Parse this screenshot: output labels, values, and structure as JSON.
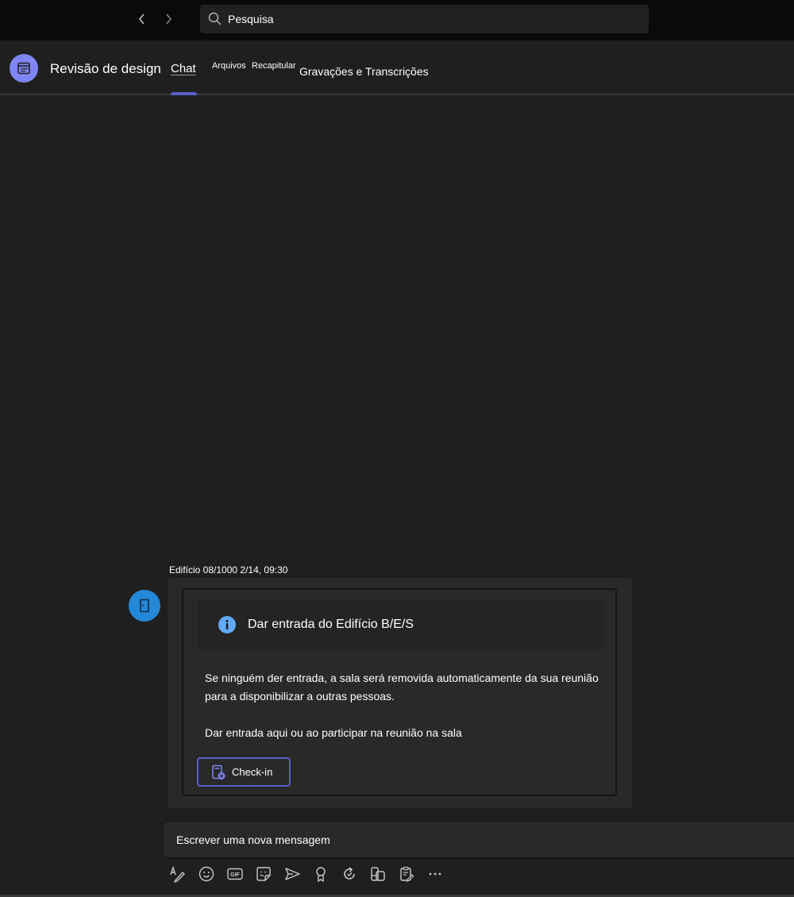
{
  "titlebar": {
    "back_icon": "chevron-left-icon",
    "forward_icon": "chevron-right-icon",
    "search": {
      "icon": "search-icon",
      "placeholder": "Pesquisa"
    }
  },
  "header": {
    "meeting_icon": "calendar-icon",
    "title": "Revisão de design",
    "tabs": [
      {
        "label": "Chat",
        "selected": true
      },
      {
        "label": "Arquivos",
        "selected": false
      },
      {
        "label": "Recapitular",
        "selected": false
      },
      {
        "label": "Gravações e Transcrições",
        "selected": false
      }
    ]
  },
  "message": {
    "sender_icon": "door-icon",
    "sender_line": "Edifício 08/1000 2/14, 09:30",
    "card": {
      "banner_icon": "info-icon",
      "banner_text": "Dar entrada do Edifício B/E/S",
      "body_paragraph_1": "Se ninguém der entrada, a sala será removida automaticamente da sua reunião para a disponibilizar a outras pessoas.",
      "body_paragraph_2": "Dar entrada aqui ou ao participar na reunião na sala",
      "button": {
        "icon": "check-in-icon",
        "label": "Check-in"
      }
    }
  },
  "compose": {
    "placeholder": "Escrever uma nova mensagem",
    "toolbar": [
      {
        "name": "format-icon"
      },
      {
        "name": "emoji-icon"
      },
      {
        "name": "gif-icon"
      },
      {
        "name": "sticker-icon"
      },
      {
        "name": "send-schedule-icon"
      },
      {
        "name": "praise-icon"
      },
      {
        "name": "loop-icon"
      },
      {
        "name": "apps-icon"
      },
      {
        "name": "forms-icon"
      },
      {
        "name": "more-options-icon"
      }
    ]
  },
  "colors": {
    "accent": "#5b5fc7",
    "meeting_avatar": "#7f85f5",
    "room_avatar": "#2488d8",
    "info_icon": "#62abf5",
    "background": "#1f1f1f",
    "titlebar": "#0a0a0a"
  }
}
